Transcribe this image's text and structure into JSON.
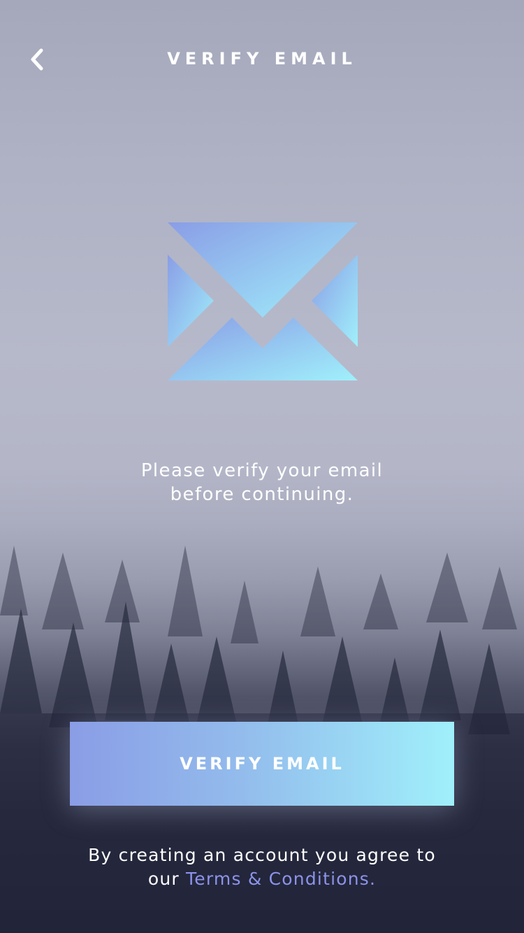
{
  "header": {
    "title": "VERIFY EMAIL",
    "back_icon": "chevron-left-icon"
  },
  "illustration": {
    "icon": "envelope-icon",
    "gradient_start": "#8a9de6",
    "gradient_end": "#a0f0fb"
  },
  "message": {
    "line1": "Please verify your email",
    "line2": "before continuing."
  },
  "actions": {
    "verify_label": "VERIFY EMAIL"
  },
  "footer": {
    "line1": "By creating an account you agree to",
    "prefix": "our",
    "terms_link": "Terms & Conditions.",
    "link_color": "#8b93ea"
  },
  "colors": {
    "background_top": "#a4a8ba",
    "background_bottom": "#22253a",
    "accent": "#8b93ea"
  }
}
